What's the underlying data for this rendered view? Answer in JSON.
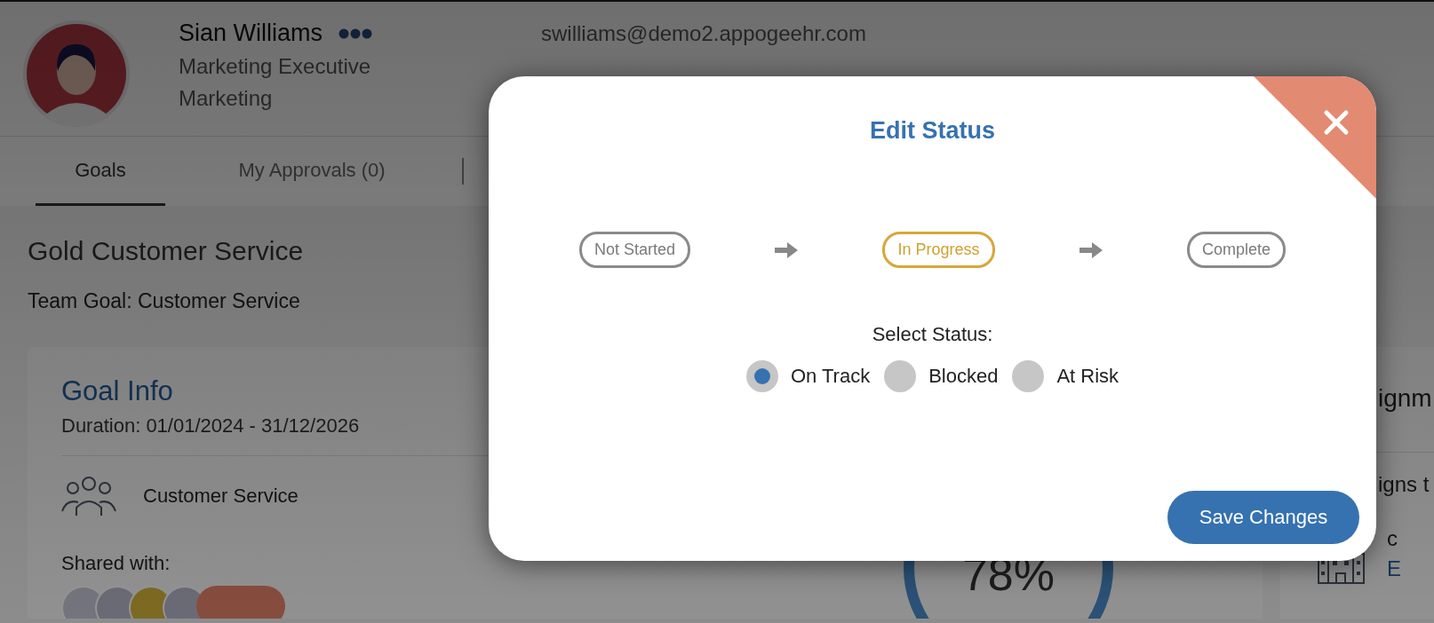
{
  "profile": {
    "name": "Sian Williams",
    "job_title": "Marketing Executive",
    "department": "Marketing",
    "email": "swilliams@demo2.appogeehr.com"
  },
  "tabs": [
    {
      "label": "Goals",
      "selected": true
    },
    {
      "label": "My Approvals (0)",
      "selected": false
    }
  ],
  "goal": {
    "title": "Gold Customer Service",
    "team_goal": "Team Goal: Customer Service"
  },
  "goal_info": {
    "heading": "Goal Info",
    "duration": "Duration: 01/01/2024 - 31/12/2026",
    "team": "Customer Service",
    "shared_label": "Shared with:",
    "progress": {
      "reading": "78%"
    }
  },
  "side_card": {
    "heading": "ignm",
    "line_1": "igns t",
    "line_2": "c",
    "link": "E"
  },
  "dialog": {
    "title": "Edit Status",
    "stages": [
      {
        "label": "Not Started",
        "selected": false
      },
      {
        "label": "In Progress",
        "selected": true
      },
      {
        "label": "Complete",
        "selected": false
      }
    ],
    "prompt": "Select Status:",
    "options": [
      {
        "label": "On Track",
        "selected": true
      },
      {
        "label": "Blocked",
        "selected": false
      },
      {
        "label": "At Risk",
        "selected": false
      }
    ],
    "save_button": "Save Changes"
  }
}
